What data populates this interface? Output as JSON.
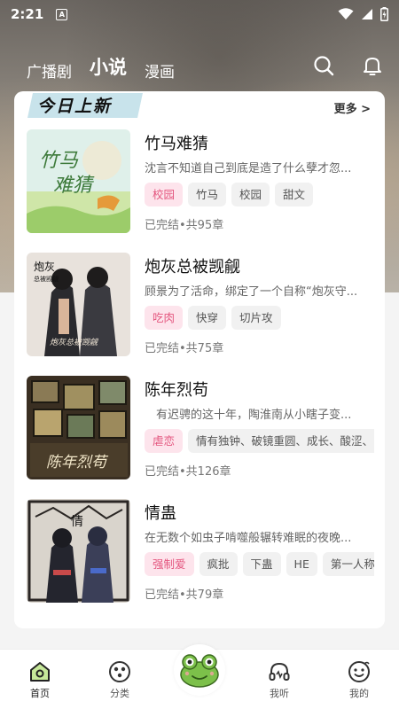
{
  "status_bar": {
    "time": "2:21",
    "notification_badge": "A"
  },
  "top_nav": {
    "tabs": [
      {
        "label": "广播剧",
        "active": false
      },
      {
        "label": "小说",
        "active": true
      },
      {
        "label": "漫画",
        "active": false
      }
    ],
    "icons": [
      "search-icon",
      "bell-icon"
    ]
  },
  "section": {
    "title": "今日上新",
    "more": "更多 >"
  },
  "books": [
    {
      "title": "竹马难猜",
      "description": "沈言不知道自己到底是造了什么孽才忽...",
      "tags": [
        {
          "label": "校园",
          "highlight": true
        },
        {
          "label": "竹马",
          "highlight": false
        },
        {
          "label": "校园",
          "highlight": false
        },
        {
          "label": "甜文",
          "highlight": false
        }
      ],
      "meta": "已完结•共95章",
      "cover_text": "竹马难猜"
    },
    {
      "title": "炮灰总被觊觎",
      "description": "顾景为了活命，绑定了一个自称“炮灰守...",
      "tags": [
        {
          "label": "吃肉",
          "highlight": true
        },
        {
          "label": "快穿",
          "highlight": false
        },
        {
          "label": "切片攻",
          "highlight": false
        }
      ],
      "meta": "已完结•共75章",
      "cover_text": "炮灰总被觊觎"
    },
    {
      "title": "陈年烈苟",
      "description": "　有迟骋的这十年，陶淮南从小瞎子变...",
      "tags": [
        {
          "label": "虐恋",
          "highlight": true
        },
        {
          "label": "情有独钟、破镜重圆、成长、酸涩、",
          "highlight": false
        }
      ],
      "meta": "已完结•共126章",
      "cover_text": "陈年烈苟"
    },
    {
      "title": "情蛊",
      "description": "在无数个如虫子啃噬般辗转难眠的夜晚...",
      "tags": [
        {
          "label": "强制爱",
          "highlight": true
        },
        {
          "label": "疯批",
          "highlight": false
        },
        {
          "label": "下蛊",
          "highlight": false
        },
        {
          "label": "HE",
          "highlight": false
        },
        {
          "label": "第一人称",
          "highlight": false
        }
      ],
      "meta": "已完结•共79章",
      "cover_text": "情"
    }
  ],
  "bottom_nav": [
    {
      "label": "首页",
      "icon": "home-icon",
      "active": true
    },
    {
      "label": "分类",
      "icon": "category-icon",
      "active": false
    },
    {
      "label": "",
      "icon": "frog-mascot-icon",
      "active": false
    },
    {
      "label": "我听",
      "icon": "headphones-icon",
      "active": false
    },
    {
      "label": "我的",
      "icon": "profile-icon",
      "active": false
    }
  ],
  "colors": {
    "accent_pink": "#e4557e",
    "tag_pink_bg": "#fde4ec",
    "frog_green": "#7cc04a"
  }
}
